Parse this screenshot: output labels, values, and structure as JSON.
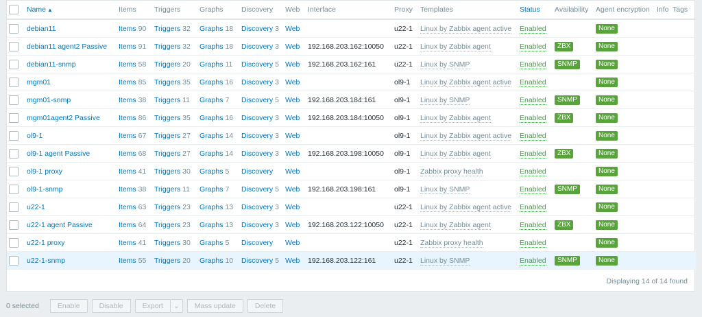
{
  "columns": {
    "name": "Name",
    "items": "Items",
    "triggers": "Triggers",
    "graphs": "Graphs",
    "discovery": "Discovery",
    "web": "Web",
    "interface": "Interface",
    "proxy": "Proxy",
    "templates": "Templates",
    "status": "Status",
    "availability": "Availability",
    "agent_encryption": "Agent encryption",
    "info": "Info",
    "tags": "Tags"
  },
  "rows": [
    {
      "name": "debian11",
      "items_label": "Items",
      "items": "90",
      "triggers_label": "Triggers",
      "triggers": "32",
      "graphs_label": "Graphs",
      "graphs": "18",
      "discovery_label": "Discovery",
      "discovery": "3",
      "web": "Web",
      "interface": "",
      "proxy": "u22-1",
      "template": "Linux by Zabbix agent active",
      "status": "Enabled",
      "availability": "",
      "encryption": "None"
    },
    {
      "name": "debian11 agent2 Passive",
      "items_label": "Items",
      "items": "91",
      "triggers_label": "Triggers",
      "triggers": "32",
      "graphs_label": "Graphs",
      "graphs": "18",
      "discovery_label": "Discovery",
      "discovery": "3",
      "web": "Web",
      "interface": "192.168.203.162:10050",
      "proxy": "u22-1",
      "template": "Linux by Zabbix agent",
      "status": "Enabled",
      "availability": "ZBX",
      "encryption": "None"
    },
    {
      "name": "debian11-snmp",
      "items_label": "Items",
      "items": "58",
      "triggers_label": "Triggers",
      "triggers": "20",
      "graphs_label": "Graphs",
      "graphs": "11",
      "discovery_label": "Discovery",
      "discovery": "5",
      "web": "Web",
      "interface": "192.168.203.162:161",
      "proxy": "u22-1",
      "template": "Linux by SNMP",
      "status": "Enabled",
      "availability": "SNMP",
      "encryption": "None"
    },
    {
      "name": "mgm01",
      "items_label": "Items",
      "items": "85",
      "triggers_label": "Triggers",
      "triggers": "35",
      "graphs_label": "Graphs",
      "graphs": "16",
      "discovery_label": "Discovery",
      "discovery": "3",
      "web": "Web",
      "interface": "",
      "proxy": "ol9-1",
      "template": "Linux by Zabbix agent active",
      "status": "Enabled",
      "availability": "",
      "encryption": "None"
    },
    {
      "name": "mgm01-snmp",
      "items_label": "Items",
      "items": "38",
      "triggers_label": "Triggers",
      "triggers": "11",
      "graphs_label": "Graphs",
      "graphs": "7",
      "discovery_label": "Discovery",
      "discovery": "5",
      "web": "Web",
      "interface": "192.168.203.184:161",
      "proxy": "ol9-1",
      "template": "Linux by SNMP",
      "status": "Enabled",
      "availability": "SNMP",
      "encryption": "None"
    },
    {
      "name": "mgm01agent2 Passive",
      "items_label": "Items",
      "items": "86",
      "triggers_label": "Triggers",
      "triggers": "35",
      "graphs_label": "Graphs",
      "graphs": "16",
      "discovery_label": "Discovery",
      "discovery": "3",
      "web": "Web",
      "interface": "192.168.203.184:10050",
      "proxy": "ol9-1",
      "template": "Linux by Zabbix agent",
      "status": "Enabled",
      "availability": "ZBX",
      "encryption": "None"
    },
    {
      "name": "ol9-1",
      "items_label": "Items",
      "items": "67",
      "triggers_label": "Triggers",
      "triggers": "27",
      "graphs_label": "Graphs",
      "graphs": "14",
      "discovery_label": "Discovery",
      "discovery": "3",
      "web": "Web",
      "interface": "",
      "proxy": "ol9-1",
      "template": "Linux by Zabbix agent active",
      "status": "Enabled",
      "availability": "",
      "encryption": "None"
    },
    {
      "name": "ol9-1 agent Passive",
      "items_label": "Items",
      "items": "68",
      "triggers_label": "Triggers",
      "triggers": "27",
      "graphs_label": "Graphs",
      "graphs": "14",
      "discovery_label": "Discovery",
      "discovery": "3",
      "web": "Web",
      "interface": "192.168.203.198:10050",
      "proxy": "ol9-1",
      "template": "Linux by Zabbix agent",
      "status": "Enabled",
      "availability": "ZBX",
      "encryption": "None"
    },
    {
      "name": "ol9-1 proxy",
      "items_label": "Items",
      "items": "41",
      "triggers_label": "Triggers",
      "triggers": "30",
      "graphs_label": "Graphs",
      "graphs": "5",
      "discovery_label": "Discovery",
      "discovery": "",
      "web": "Web",
      "interface": "",
      "proxy": "ol9-1",
      "template": "Zabbix proxy health",
      "status": "Enabled",
      "availability": "",
      "encryption": "None"
    },
    {
      "name": "ol9-1-snmp",
      "items_label": "Items",
      "items": "38",
      "triggers_label": "Triggers",
      "triggers": "11",
      "graphs_label": "Graphs",
      "graphs": "7",
      "discovery_label": "Discovery",
      "discovery": "5",
      "web": "Web",
      "interface": "192.168.203.198:161",
      "proxy": "ol9-1",
      "template": "Linux by SNMP",
      "status": "Enabled",
      "availability": "SNMP",
      "encryption": "None"
    },
    {
      "name": "u22-1",
      "items_label": "Items",
      "items": "63",
      "triggers_label": "Triggers",
      "triggers": "23",
      "graphs_label": "Graphs",
      "graphs": "13",
      "discovery_label": "Discovery",
      "discovery": "3",
      "web": "Web",
      "interface": "",
      "proxy": "u22-1",
      "template": "Linux by Zabbix agent active",
      "status": "Enabled",
      "availability": "",
      "encryption": "None"
    },
    {
      "name": "u22-1 agent Passive",
      "items_label": "Items",
      "items": "64",
      "triggers_label": "Triggers",
      "triggers": "23",
      "graphs_label": "Graphs",
      "graphs": "13",
      "discovery_label": "Discovery",
      "discovery": "3",
      "web": "Web",
      "interface": "192.168.203.122:10050",
      "proxy": "u22-1",
      "template": "Linux by Zabbix agent",
      "status": "Enabled",
      "availability": "ZBX",
      "encryption": "None"
    },
    {
      "name": "u22-1 proxy",
      "items_label": "Items",
      "items": "41",
      "triggers_label": "Triggers",
      "triggers": "30",
      "graphs_label": "Graphs",
      "graphs": "5",
      "discovery_label": "Discovery",
      "discovery": "",
      "web": "Web",
      "interface": "",
      "proxy": "u22-1",
      "template": "Zabbix proxy health",
      "status": "Enabled",
      "availability": "",
      "encryption": "None"
    },
    {
      "name": "u22-1-snmp",
      "items_label": "Items",
      "items": "55",
      "triggers_label": "Triggers",
      "triggers": "20",
      "graphs_label": "Graphs",
      "graphs": "10",
      "discovery_label": "Discovery",
      "discovery": "5",
      "web": "Web",
      "interface": "192.168.203.122:161",
      "proxy": "u22-1",
      "template": "Linux by SNMP",
      "status": "Enabled",
      "availability": "SNMP",
      "encryption": "None"
    }
  ],
  "footer": {
    "displaying": "Displaying 14 of 14 found"
  },
  "actions": {
    "selected": "0 selected",
    "enable": "Enable",
    "disable": "Disable",
    "export": "Export",
    "mass_update": "Mass update",
    "delete": "Delete"
  },
  "colors": {
    "accent": "#0275b8",
    "enabled": "#429e47",
    "badge": "#59a33c",
    "highlight_row": "#e8f5ff"
  }
}
